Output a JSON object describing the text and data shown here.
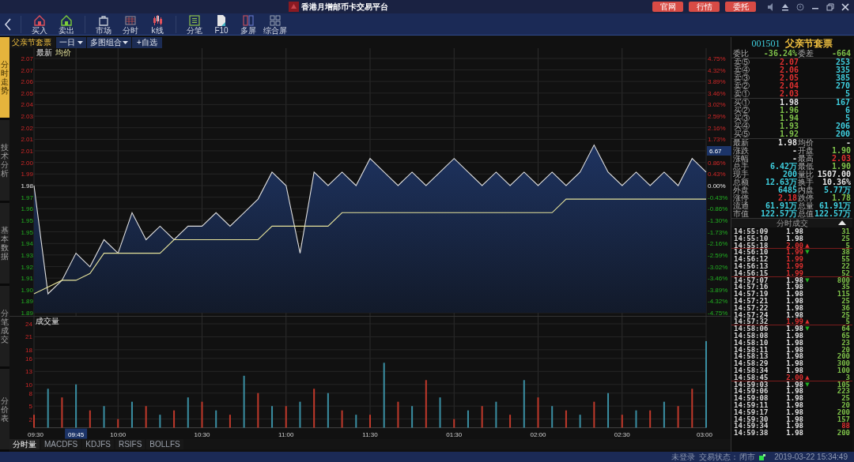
{
  "title_bar": {
    "title": "香港月增邮币卡交易平台",
    "buttons": [
      "官网",
      "行情",
      "委托"
    ]
  },
  "toolbar": {
    "groups": [
      [
        {
          "label": "买入"
        },
        {
          "label": "卖出"
        }
      ],
      [
        {
          "label": "市场"
        },
        {
          "label": "分时"
        },
        {
          "label": "k线"
        }
      ],
      [
        {
          "label": "分笔"
        },
        {
          "label": "F10"
        },
        {
          "label": "多屏"
        },
        {
          "label": "综合屏"
        }
      ]
    ]
  },
  "side_tabs": [
    {
      "label": "分时走势",
      "selected": true
    },
    {
      "label": "技术分析",
      "selected": false
    },
    {
      "label": "基本数据",
      "selected": false
    },
    {
      "label": "分笔成交",
      "selected": false
    },
    {
      "label": "分价表",
      "selected": false
    }
  ],
  "chart_header": {
    "symbol": "父亲节套票",
    "selectors": [
      {
        "label": "一日",
        "dropdown": true
      },
      {
        "label": "多图组合",
        "dropdown": true
      },
      {
        "label": "+自选",
        "dropdown": false
      }
    ]
  },
  "price_chart": {
    "chart_data": {
      "type": "area",
      "grid": true,
      "series": [
        {
          "name": "最新",
          "type": "area",
          "color": "#e0e0e0",
          "values": [
            1.98,
            1.9,
            1.91,
            1.93,
            1.92,
            1.94,
            1.93,
            1.96,
            1.94,
            1.95,
            1.94,
            1.95,
            1.95,
            1.96,
            1.95,
            1.96,
            1.97,
            1.99,
            1.98,
            1.93,
            1.99,
            1.98,
            1.99,
            1.98,
            2.0,
            1.99,
            1.98,
            1.99,
            1.98,
            1.99,
            2.0,
            1.99,
            1.98,
            1.99,
            1.98,
            1.99,
            1.98,
            1.99,
            1.98,
            1.99,
            2.01,
            1.99,
            1.98,
            1.99,
            1.98,
            1.99,
            1.98,
            2.0,
            1.99
          ]
        },
        {
          "name": "均价",
          "type": "line",
          "color": "#e6e39c",
          "values": [
            1.9,
            1.905,
            1.91,
            1.91,
            1.915,
            1.93,
            1.93,
            1.93,
            1.93,
            1.93,
            1.94,
            1.94,
            1.94,
            1.94,
            1.94,
            1.94,
            1.94,
            1.95,
            1.95,
            1.95,
            1.95,
            1.95,
            1.96,
            1.96,
            1.96,
            1.96,
            1.96,
            1.96,
            1.96,
            1.96,
            1.96,
            1.96,
            1.96,
            1.96,
            1.96,
            1.96,
            1.96,
            1.96,
            1.97,
            1.97,
            1.97,
            1.97,
            1.97,
            1.97,
            1.97,
            1.97,
            1.97,
            1.97,
            1.97
          ]
        }
      ],
      "ylim": [
        1.886,
        2.074
      ],
      "yticks": [
        {
          "value": 2.074,
          "label": "2.07"
        },
        {
          "value": 2.0655,
          "label": "2.07"
        },
        {
          "value": 2.057,
          "label": "2.06"
        },
        {
          "value": 2.0484,
          "label": "2.05"
        },
        {
          "value": 2.0399,
          "label": "2.04"
        },
        {
          "value": 2.0313,
          "label": "2.03"
        },
        {
          "value": 2.0228,
          "label": "2.02"
        },
        {
          "value": 2.0142,
          "label": "2.01"
        },
        {
          "value": 2.0057,
          "label": "2.01"
        },
        {
          "value": 1.9971,
          "label": "2.00"
        },
        {
          "value": 1.9886,
          "label": "1.99"
        },
        {
          "value": 1.98,
          "label": "1.98"
        },
        {
          "value": 1.9714,
          "label": "1.97"
        },
        {
          "value": 1.9629,
          "label": "1.96"
        },
        {
          "value": 1.9543,
          "label": "1.95"
        },
        {
          "value": 1.9458,
          "label": "1.95"
        },
        {
          "value": 1.9372,
          "label": "1.94"
        },
        {
          "value": 1.9287,
          "label": "1.93"
        },
        {
          "value": 1.9201,
          "label": "1.92"
        },
        {
          "value": 1.9116,
          "label": "1.91"
        },
        {
          "value": 1.903,
          "label": "1.90"
        },
        {
          "value": 1.8945,
          "label": "1.89"
        },
        {
          "value": 1.886,
          "label": "1.89"
        }
      ]
    },
    "right_axis": [
      {
        "text": "4.75%",
        "kind": "up",
        "cursor": false
      },
      {
        "text": "4.32%",
        "kind": "up",
        "cursor": false
      },
      {
        "text": "3.89%",
        "kind": "up",
        "cursor": false
      },
      {
        "text": "3.46%",
        "kind": "up",
        "cursor": false
      },
      {
        "text": "3.02%",
        "kind": "up",
        "cursor": false
      },
      {
        "text": "2.59%",
        "kind": "up",
        "cursor": false
      },
      {
        "text": "2.16%",
        "kind": "up",
        "cursor": false
      },
      {
        "text": "1.73%",
        "kind": "up",
        "cursor": false
      },
      {
        "text": "6.67",
        "kind": "up",
        "cursor": true
      },
      {
        "text": "0.86%",
        "kind": "up",
        "cursor": false
      },
      {
        "text": "0.43%",
        "kind": "up",
        "cursor": false
      },
      {
        "text": "0.00%",
        "kind": "flat",
        "cursor": false
      },
      {
        "text": "-0.43%",
        "kind": "down",
        "cursor": false
      },
      {
        "text": "-0.86%",
        "kind": "down",
        "cursor": false
      },
      {
        "text": "-1.30%",
        "kind": "down",
        "cursor": false
      },
      {
        "text": "-1.73%",
        "kind": "down",
        "cursor": false
      },
      {
        "text": "-2.16%",
        "kind": "down",
        "cursor": false
      },
      {
        "text": "-2.59%",
        "kind": "down",
        "cursor": false
      },
      {
        "text": "-3.02%",
        "kind": "down",
        "cursor": false
      },
      {
        "text": "-3.46%",
        "kind": "down",
        "cursor": false
      },
      {
        "text": "-3.89%",
        "kind": "down",
        "cursor": false
      },
      {
        "text": "-4.32%",
        "kind": "down",
        "cursor": false
      },
      {
        "text": "-4.75%",
        "kind": "down",
        "cursor": false
      }
    ]
  },
  "volume_chart": {
    "chart_data": {
      "type": "bar",
      "title": "成交量",
      "grid": true,
      "categories": [
        "09:30",
        null,
        null,
        "09:45",
        null,
        null,
        "10:00",
        null,
        null,
        null,
        null,
        null,
        "10:30",
        null,
        null,
        null,
        null,
        null,
        "11:00",
        null,
        null,
        null,
        null,
        null,
        "11:30",
        null,
        null,
        null,
        null,
        null,
        "01:30",
        null,
        null,
        null,
        null,
        null,
        "02:00",
        null,
        null,
        null,
        null,
        null,
        "02:30",
        null,
        null,
        null,
        null,
        null,
        "03:00"
      ],
      "series": [
        {
          "color": "#c0392b",
          "values": [
            3,
            null,
            7,
            null,
            4,
            null,
            2,
            null,
            5,
            null,
            4,
            null,
            6,
            null,
            3,
            null,
            8,
            null,
            5,
            null,
            9,
            null,
            4,
            null,
            3,
            null,
            6,
            null,
            11,
            null,
            2,
            null,
            5,
            null,
            3,
            null,
            7,
            null,
            4,
            null,
            6,
            null,
            3,
            null,
            4,
            null,
            5,
            9,
            null
          ]
        },
        {
          "color": "#3a8fa3",
          "values": [
            null,
            9,
            null,
            10,
            null,
            5,
            null,
            6,
            null,
            3,
            null,
            7,
            null,
            4,
            null,
            12,
            null,
            5,
            null,
            6,
            null,
            8,
            null,
            3,
            null,
            15,
            null,
            5,
            null,
            7,
            null,
            4,
            null,
            6,
            null,
            11,
            null,
            5,
            null,
            3,
            null,
            8,
            null,
            4,
            null,
            6,
            null,
            null,
            20
          ]
        }
      ],
      "ylim": [
        0,
        24
      ],
      "yticks": [
        24,
        21,
        18,
        16,
        13,
        10,
        8,
        5,
        2
      ],
      "annotations": [
        {
          "x": "09:45"
        }
      ]
    }
  },
  "bottom_tabs": [
    {
      "label": "分时量",
      "selected": true
    },
    {
      "label": "MACDFS",
      "selected": false
    },
    {
      "label": "KDJFS",
      "selected": false
    },
    {
      "label": "RSIFS",
      "selected": false
    },
    {
      "label": "BOLLFS",
      "selected": false
    }
  ],
  "quote": {
    "code": "001501",
    "name": "父亲节套票",
    "ratio": [
      {
        "label": "委比",
        "value": {
          "text": "-36.24%",
          "color": "#7fc24a"
        }
      },
      {
        "label": "委差",
        "value": {
          "text": "-664",
          "color": "#7fc24a"
        }
      }
    ],
    "sell": [
      {
        "label": "卖⑤",
        "price": {
          "text": "2.07",
          "color": "#e03030"
        },
        "volume": "253"
      },
      {
        "label": "卖④",
        "price": {
          "text": "2.06",
          "color": "#e03030"
        },
        "volume": "335"
      },
      {
        "label": "卖③",
        "price": {
          "text": "2.05",
          "color": "#e03030"
        },
        "volume": "385"
      },
      {
        "label": "卖②",
        "price": {
          "text": "2.04",
          "color": "#e03030"
        },
        "volume": "270"
      },
      {
        "label": "卖①",
        "price": {
          "text": "2.03",
          "color": "#e03030"
        },
        "volume": "5"
      }
    ],
    "buy": [
      {
        "label": "买①",
        "price": {
          "text": "1.98",
          "color": "#e6e6e6"
        },
        "volume": "167"
      },
      {
        "label": "买②",
        "price": {
          "text": "1.96",
          "color": "#7fc24a"
        },
        "volume": "6"
      },
      {
        "label": "买③",
        "price": {
          "text": "1.94",
          "color": "#7fc24a"
        },
        "volume": "5"
      },
      {
        "label": "买④",
        "price": {
          "text": "1.93",
          "color": "#7fc24a"
        },
        "volume": "206"
      },
      {
        "label": "买⑤",
        "price": {
          "text": "1.92",
          "color": "#7fc24a"
        },
        "volume": "200"
      }
    ],
    "stats": [
      [
        {
          "label": "最新",
          "value": {
            "text": "1.98",
            "color": "#e6e6e6"
          }
        },
        {
          "label": "均价",
          "value": {
            "text": "-"
          }
        }
      ],
      [
        {
          "label": "涨跌",
          "value": {
            "text": "-"
          }
        },
        {
          "label": "开盘",
          "value": {
            "text": "1.90",
            "color": "#7fc24a"
          }
        }
      ],
      [
        {
          "label": "涨幅",
          "value": {
            "text": "-"
          }
        },
        {
          "label": "最高",
          "value": {
            "text": "2.03",
            "color": "#e03030"
          }
        }
      ],
      [
        {
          "label": "总手",
          "value": {
            "text": "6.42万",
            "color": "#3fd0e0"
          }
        },
        {
          "label": "最低",
          "value": {
            "text": "1.90",
            "color": "#7fc24a"
          }
        }
      ],
      [
        {
          "label": "现手",
          "value": {
            "text": "200",
            "color": "#3fd0e0"
          }
        },
        {
          "label": "量比",
          "value": {
            "text": "1507.00",
            "color": "#e6e6e6"
          }
        }
      ],
      [
        {
          "label": "总额",
          "value": {
            "text": "12.63万",
            "color": "#3fd0e0"
          }
        },
        {
          "label": "换手",
          "value": {
            "text": "10.36%",
            "color": "#e6e6e6"
          }
        }
      ],
      [
        {
          "label": "外盘",
          "value": {
            "text": "6485",
            "color": "#3fd0e0"
          }
        },
        {
          "label": "内盘",
          "value": {
            "text": "5.77万",
            "color": "#3fd0e0"
          }
        }
      ],
      [
        {
          "label": "涨停",
          "value": {
            "text": "2.18",
            "color": "#e03030"
          }
        },
        {
          "label": "跌停",
          "value": {
            "text": "1.78",
            "color": "#7fc24a"
          }
        }
      ],
      [
        {
          "label": "流通",
          "value": {
            "text": "61.91万",
            "color": "#3fd0e0"
          }
        },
        {
          "label": "总量",
          "value": {
            "text": "61.91万",
            "color": "#3fd0e0"
          }
        }
      ],
      [
        {
          "label": "市值",
          "value": {
            "text": "122.57万",
            "color": "#3fd0e0"
          }
        },
        {
          "label": "总值",
          "value": {
            "text": "122.57万",
            "color": "#3fd0e0"
          }
        }
      ]
    ]
  },
  "trades": {
    "title": "分时成交",
    "rows": [
      {
        "time": "14:55:09",
        "price": {
          "text": "1.98",
          "color": "#e6e6e6"
        },
        "volume": {
          "text": "31",
          "color": "#7fc24a"
        },
        "divider_above": false
      },
      {
        "time": "14:55:10",
        "price": {
          "text": "1.98",
          "color": "#e6e6e6"
        },
        "volume": {
          "text": "25",
          "color": "#7fc24a"
        },
        "divider_above": false
      },
      {
        "time": "14:55:18",
        "price": {
          "text": "2.00",
          "color": "#e03030"
        },
        "arrow": {
          "text": "▲",
          "color": "#e03030"
        },
        "volume": {
          "text": "5",
          "color": "#7fc24a"
        },
        "divider_above": false
      },
      {
        "time": "14:56:10",
        "price": {
          "text": "1.99",
          "color": "#e03030"
        },
        "arrow": {
          "text": "▼",
          "color": "#22b022"
        },
        "volume": {
          "text": "38",
          "color": "#7fc24a"
        },
        "divider_above": true
      },
      {
        "time": "14:56:12",
        "price": {
          "text": "1.99",
          "color": "#e03030"
        },
        "volume": {
          "text": "55",
          "color": "#7fc24a"
        },
        "divider_above": false
      },
      {
        "time": "14:56:13",
        "price": {
          "text": "1.99",
          "color": "#e03030"
        },
        "volume": {
          "text": "22",
          "color": "#7fc24a"
        },
        "divider_above": false
      },
      {
        "time": "14:56:15",
        "price": {
          "text": "1.99",
          "color": "#e03030"
        },
        "volume": {
          "text": "52",
          "color": "#7fc24a"
        },
        "divider_above": false
      },
      {
        "time": "14:57:07",
        "price": {
          "text": "1.98",
          "color": "#e6e6e6"
        },
        "arrow": {
          "text": "▼",
          "color": "#22b022"
        },
        "volume": {
          "text": "800",
          "color": "#7fc24a"
        },
        "divider_above": true
      },
      {
        "time": "14:57:16",
        "price": {
          "text": "1.98",
          "color": "#e6e6e6"
        },
        "volume": {
          "text": "35",
          "color": "#7fc24a"
        },
        "divider_above": false
      },
      {
        "time": "14:57:19",
        "price": {
          "text": "1.98",
          "color": "#e6e6e6"
        },
        "volume": {
          "text": "115",
          "color": "#7fc24a"
        },
        "divider_above": false
      },
      {
        "time": "14:57:21",
        "price": {
          "text": "1.98",
          "color": "#e6e6e6"
        },
        "volume": {
          "text": "25",
          "color": "#7fc24a"
        },
        "divider_above": false
      },
      {
        "time": "14:57:22",
        "price": {
          "text": "1.98",
          "color": "#e6e6e6"
        },
        "volume": {
          "text": "36",
          "color": "#7fc24a"
        },
        "divider_above": false
      },
      {
        "time": "14:57:24",
        "price": {
          "text": "1.98",
          "color": "#e6e6e6"
        },
        "volume": {
          "text": "25",
          "color": "#7fc24a"
        },
        "divider_above": false
      },
      {
        "time": "14:57:32",
        "price": {
          "text": "1.99",
          "color": "#e03030"
        },
        "arrow": {
          "text": "▲",
          "color": "#e03030"
        },
        "volume": {
          "text": "5",
          "color": "#7fc24a"
        },
        "divider_above": false
      },
      {
        "time": "14:58:06",
        "price": {
          "text": "1.98",
          "color": "#e6e6e6"
        },
        "arrow": {
          "text": "▼",
          "color": "#22b022"
        },
        "volume": {
          "text": "64",
          "color": "#7fc24a"
        },
        "divider_above": true
      },
      {
        "time": "14:58:08",
        "price": {
          "text": "1.98",
          "color": "#e6e6e6"
        },
        "volume": {
          "text": "65",
          "color": "#7fc24a"
        },
        "divider_above": false
      },
      {
        "time": "14:58:10",
        "price": {
          "text": "1.98",
          "color": "#e6e6e6"
        },
        "volume": {
          "text": "23",
          "color": "#7fc24a"
        },
        "divider_above": false
      },
      {
        "time": "14:58:11",
        "price": {
          "text": "1.98",
          "color": "#e6e6e6"
        },
        "volume": {
          "text": "20",
          "color": "#7fc24a"
        },
        "divider_above": false
      },
      {
        "time": "14:58:13",
        "price": {
          "text": "1.98",
          "color": "#e6e6e6"
        },
        "volume": {
          "text": "200",
          "color": "#7fc24a"
        },
        "divider_above": false
      },
      {
        "time": "14:58:29",
        "price": {
          "text": "1.98",
          "color": "#e6e6e6"
        },
        "volume": {
          "text": "300",
          "color": "#7fc24a"
        },
        "divider_above": false
      },
      {
        "time": "14:58:34",
        "price": {
          "text": "1.98",
          "color": "#e6e6e6"
        },
        "volume": {
          "text": "100",
          "color": "#7fc24a"
        },
        "divider_above": false
      },
      {
        "time": "14:58:45",
        "price": {
          "text": "2.00",
          "color": "#e03030"
        },
        "arrow": {
          "text": "▲",
          "color": "#e03030"
        },
        "volume": {
          "text": "3",
          "color": "#7fc24a"
        },
        "divider_above": false
      },
      {
        "time": "14:59:03",
        "price": {
          "text": "1.98",
          "color": "#e6e6e6"
        },
        "arrow": {
          "text": "▼",
          "color": "#22b022"
        },
        "volume": {
          "text": "105",
          "color": "#7fc24a"
        },
        "divider_above": true
      },
      {
        "time": "14:59:06",
        "price": {
          "text": "1.98",
          "color": "#e6e6e6"
        },
        "volume": {
          "text": "223",
          "color": "#7fc24a"
        },
        "divider_above": false
      },
      {
        "time": "14:59:08",
        "price": {
          "text": "1.98",
          "color": "#e6e6e6"
        },
        "volume": {
          "text": "25",
          "color": "#7fc24a"
        },
        "divider_above": false
      },
      {
        "time": "14:59:11",
        "price": {
          "text": "1.98",
          "color": "#e6e6e6"
        },
        "volume": {
          "text": "20",
          "color": "#7fc24a"
        },
        "divider_above": false
      },
      {
        "time": "14:59:17",
        "price": {
          "text": "1.98",
          "color": "#e6e6e6"
        },
        "volume": {
          "text": "200",
          "color": "#7fc24a"
        },
        "divider_above": false
      },
      {
        "time": "14:59:30",
        "price": {
          "text": "1.98",
          "color": "#e6e6e6"
        },
        "volume": {
          "text": "157",
          "color": "#7fc24a"
        },
        "divider_above": false
      },
      {
        "time": "14:59:34",
        "price": {
          "text": "1.98",
          "color": "#e6e6e6"
        },
        "volume": {
          "text": "88",
          "color": "#e03030"
        },
        "divider_above": false
      },
      {
        "time": "14:59:38",
        "price": {
          "text": "1.98",
          "color": "#e6e6e6"
        },
        "volume": {
          "text": "200",
          "color": "#7fc24a"
        },
        "divider_above": false
      }
    ]
  },
  "status_bar": {
    "login": "未登录",
    "trade_state_label": "交易状态：",
    "trade_state": "闭市",
    "datetime": "2019-03-22 15:34:49"
  }
}
